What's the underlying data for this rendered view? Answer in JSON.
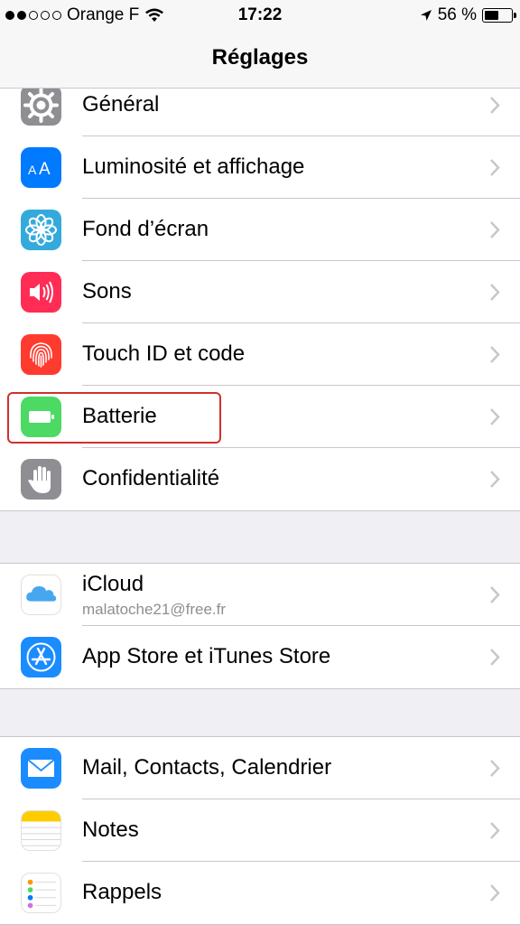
{
  "status_bar": {
    "carrier": "Orange F",
    "time": "17:22",
    "battery_percent": "56 %",
    "battery_level": 0.56,
    "signal_bars": 2,
    "icons": [
      "signal-dots-icon",
      "wifi-icon",
      "location-arrow-icon",
      "battery-icon"
    ]
  },
  "nav": {
    "title": "Réglages"
  },
  "groups": [
    {
      "items": [
        {
          "label": "Général",
          "icon": "gear-icon",
          "color": "#8e8e93"
        },
        {
          "label": "Luminosité et affichage",
          "icon": "text-size-icon",
          "color": "#007aff"
        },
        {
          "label": "Fond d’écran",
          "icon": "wallpaper-flower-icon",
          "color": "#34aadc"
        },
        {
          "label": "Sons",
          "icon": "speaker-icon",
          "color": "#ff2d55"
        },
        {
          "label": "Touch ID et code",
          "icon": "fingerprint-icon",
          "color": "#ff3b30"
        },
        {
          "label": "Batterie",
          "icon": "battery-icon",
          "color": "#4cd964",
          "highlighted": true
        },
        {
          "label": "Confidentialité",
          "icon": "hand-icon",
          "color": "#8e8e93"
        }
      ]
    },
    {
      "items": [
        {
          "label": "iCloud",
          "sublabel": "malatoche21@free.fr",
          "icon": "cloud-icon",
          "color": "#ffffff"
        },
        {
          "label": "App Store et iTunes Store",
          "icon": "app-store-icon",
          "color": "#1a8cff"
        }
      ]
    },
    {
      "items": [
        {
          "label": "Mail, Contacts, Calendrier",
          "icon": "mail-icon",
          "color": "#1a8cff"
        },
        {
          "label": "Notes",
          "icon": "notes-icon",
          "color": "#ffcc00"
        },
        {
          "label": "Rappels",
          "icon": "reminders-icon",
          "color": "#ffffff"
        }
      ]
    }
  ]
}
